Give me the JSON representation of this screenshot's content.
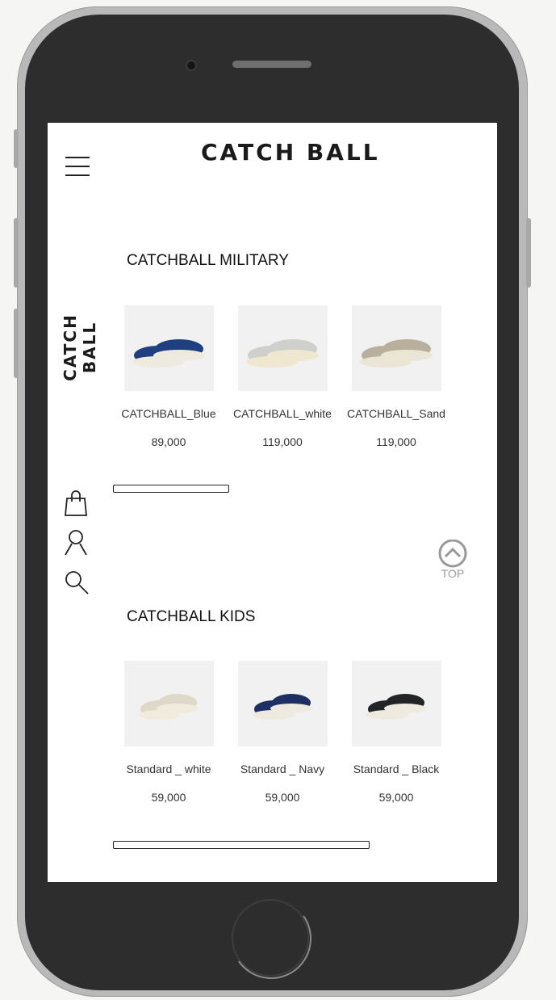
{
  "header": {
    "logo": "CATCH BALL"
  },
  "side_logo": "CATCH BALL",
  "icons": {
    "menu": "hamburger-menu-icon",
    "bag": "shopping-bag-icon",
    "user": "user-icon",
    "search": "search-icon",
    "top": "chevron-up-icon"
  },
  "top_button": {
    "label": "TOP"
  },
  "sections": [
    {
      "title": "CATCHBALL MILITARY",
      "products": [
        {
          "name": "CATCHBALL_Blue",
          "price": "89,000",
          "color": "#1f3f7f"
        },
        {
          "name": "CATCHBALL_white",
          "price": "119,000",
          "color": "#cfcfcc"
        },
        {
          "name": "CATCHBALL_Sand",
          "price": "119,000",
          "color": "#b8b09c"
        }
      ]
    },
    {
      "title": "CATCHBALL KIDS",
      "products": [
        {
          "name": "Standard _ white",
          "price": "59,000",
          "color": "#ddd8c8"
        },
        {
          "name": "Standard _ Navy",
          "price": "59,000",
          "color": "#1d2f63"
        },
        {
          "name": "Standard _ Black",
          "price": "59,000",
          "color": "#222428"
        }
      ]
    }
  ]
}
